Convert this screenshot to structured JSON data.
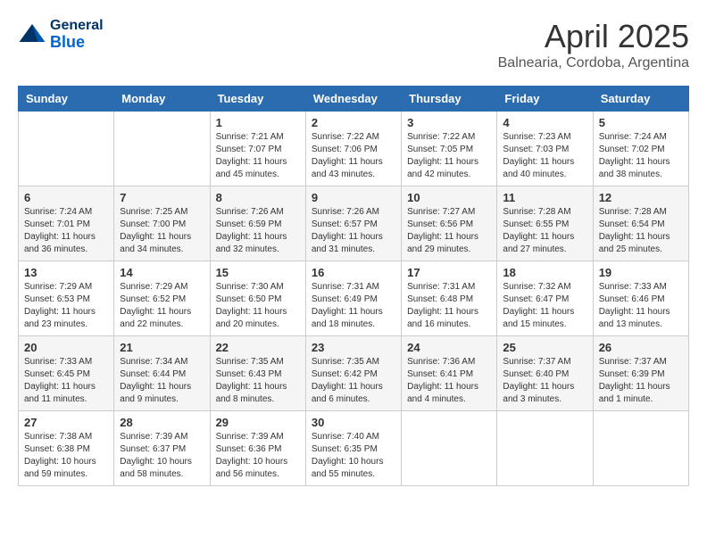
{
  "header": {
    "logo_general": "General",
    "logo_blue": "Blue",
    "month_title": "April 2025",
    "subtitle": "Balnearia, Cordoba, Argentina"
  },
  "days_of_week": [
    "Sunday",
    "Monday",
    "Tuesday",
    "Wednesday",
    "Thursday",
    "Friday",
    "Saturday"
  ],
  "weeks": [
    [
      {
        "day": "",
        "info": ""
      },
      {
        "day": "",
        "info": ""
      },
      {
        "day": "1",
        "info": "Sunrise: 7:21 AM\nSunset: 7:07 PM\nDaylight: 11 hours and 45 minutes."
      },
      {
        "day": "2",
        "info": "Sunrise: 7:22 AM\nSunset: 7:06 PM\nDaylight: 11 hours and 43 minutes."
      },
      {
        "day": "3",
        "info": "Sunrise: 7:22 AM\nSunset: 7:05 PM\nDaylight: 11 hours and 42 minutes."
      },
      {
        "day": "4",
        "info": "Sunrise: 7:23 AM\nSunset: 7:03 PM\nDaylight: 11 hours and 40 minutes."
      },
      {
        "day": "5",
        "info": "Sunrise: 7:24 AM\nSunset: 7:02 PM\nDaylight: 11 hours and 38 minutes."
      }
    ],
    [
      {
        "day": "6",
        "info": "Sunrise: 7:24 AM\nSunset: 7:01 PM\nDaylight: 11 hours and 36 minutes."
      },
      {
        "day": "7",
        "info": "Sunrise: 7:25 AM\nSunset: 7:00 PM\nDaylight: 11 hours and 34 minutes."
      },
      {
        "day": "8",
        "info": "Sunrise: 7:26 AM\nSunset: 6:59 PM\nDaylight: 11 hours and 32 minutes."
      },
      {
        "day": "9",
        "info": "Sunrise: 7:26 AM\nSunset: 6:57 PM\nDaylight: 11 hours and 31 minutes."
      },
      {
        "day": "10",
        "info": "Sunrise: 7:27 AM\nSunset: 6:56 PM\nDaylight: 11 hours and 29 minutes."
      },
      {
        "day": "11",
        "info": "Sunrise: 7:28 AM\nSunset: 6:55 PM\nDaylight: 11 hours and 27 minutes."
      },
      {
        "day": "12",
        "info": "Sunrise: 7:28 AM\nSunset: 6:54 PM\nDaylight: 11 hours and 25 minutes."
      }
    ],
    [
      {
        "day": "13",
        "info": "Sunrise: 7:29 AM\nSunset: 6:53 PM\nDaylight: 11 hours and 23 minutes."
      },
      {
        "day": "14",
        "info": "Sunrise: 7:29 AM\nSunset: 6:52 PM\nDaylight: 11 hours and 22 minutes."
      },
      {
        "day": "15",
        "info": "Sunrise: 7:30 AM\nSunset: 6:50 PM\nDaylight: 11 hours and 20 minutes."
      },
      {
        "day": "16",
        "info": "Sunrise: 7:31 AM\nSunset: 6:49 PM\nDaylight: 11 hours and 18 minutes."
      },
      {
        "day": "17",
        "info": "Sunrise: 7:31 AM\nSunset: 6:48 PM\nDaylight: 11 hours and 16 minutes."
      },
      {
        "day": "18",
        "info": "Sunrise: 7:32 AM\nSunset: 6:47 PM\nDaylight: 11 hours and 15 minutes."
      },
      {
        "day": "19",
        "info": "Sunrise: 7:33 AM\nSunset: 6:46 PM\nDaylight: 11 hours and 13 minutes."
      }
    ],
    [
      {
        "day": "20",
        "info": "Sunrise: 7:33 AM\nSunset: 6:45 PM\nDaylight: 11 hours and 11 minutes."
      },
      {
        "day": "21",
        "info": "Sunrise: 7:34 AM\nSunset: 6:44 PM\nDaylight: 11 hours and 9 minutes."
      },
      {
        "day": "22",
        "info": "Sunrise: 7:35 AM\nSunset: 6:43 PM\nDaylight: 11 hours and 8 minutes."
      },
      {
        "day": "23",
        "info": "Sunrise: 7:35 AM\nSunset: 6:42 PM\nDaylight: 11 hours and 6 minutes."
      },
      {
        "day": "24",
        "info": "Sunrise: 7:36 AM\nSunset: 6:41 PM\nDaylight: 11 hours and 4 minutes."
      },
      {
        "day": "25",
        "info": "Sunrise: 7:37 AM\nSunset: 6:40 PM\nDaylight: 11 hours and 3 minutes."
      },
      {
        "day": "26",
        "info": "Sunrise: 7:37 AM\nSunset: 6:39 PM\nDaylight: 11 hours and 1 minute."
      }
    ],
    [
      {
        "day": "27",
        "info": "Sunrise: 7:38 AM\nSunset: 6:38 PM\nDaylight: 10 hours and 59 minutes."
      },
      {
        "day": "28",
        "info": "Sunrise: 7:39 AM\nSunset: 6:37 PM\nDaylight: 10 hours and 58 minutes."
      },
      {
        "day": "29",
        "info": "Sunrise: 7:39 AM\nSunset: 6:36 PM\nDaylight: 10 hours and 56 minutes."
      },
      {
        "day": "30",
        "info": "Sunrise: 7:40 AM\nSunset: 6:35 PM\nDaylight: 10 hours and 55 minutes."
      },
      {
        "day": "",
        "info": ""
      },
      {
        "day": "",
        "info": ""
      },
      {
        "day": "",
        "info": ""
      }
    ]
  ]
}
